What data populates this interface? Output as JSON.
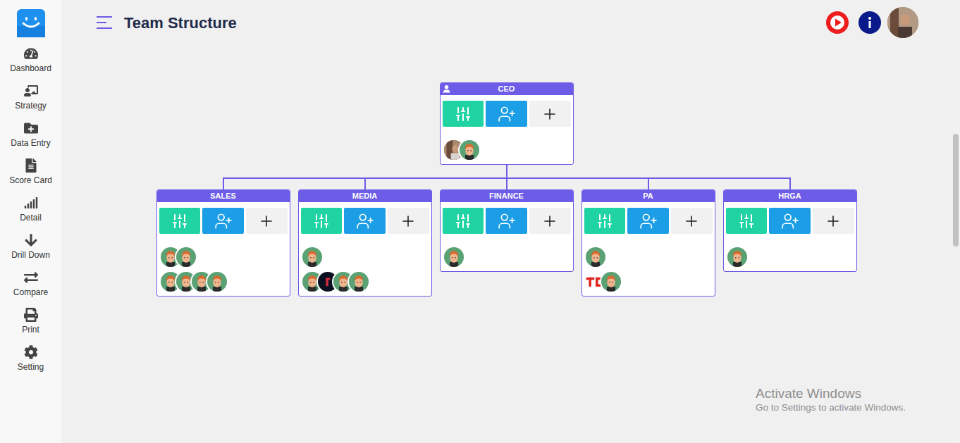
{
  "sidebar": {
    "items": [
      {
        "label": "Dashboard"
      },
      {
        "label": "Strategy"
      },
      {
        "label": "Data Entry"
      },
      {
        "label": "Score Card"
      },
      {
        "label": "Detail"
      },
      {
        "label": "Drill Down"
      },
      {
        "label": "Compare"
      },
      {
        "label": "Print"
      },
      {
        "label": "Setting"
      }
    ]
  },
  "header": {
    "title": "Team Structure"
  },
  "chart": {
    "root": {
      "title": "CEO",
      "avatar_rows": [
        [
          {
            "kind": "photo"
          },
          {
            "kind": "cartoon"
          }
        ]
      ]
    },
    "children": [
      {
        "title": "SALES",
        "avatar_rows": [
          [
            {
              "kind": "cartoon"
            },
            {
              "kind": "cartoon"
            }
          ],
          [
            {
              "kind": "cartoon"
            },
            {
              "kind": "cartoon"
            },
            {
              "kind": "cartoon"
            },
            {
              "kind": "cartoon"
            }
          ]
        ]
      },
      {
        "title": "MEDIA",
        "avatar_rows": [
          [
            {
              "kind": "cartoon"
            }
          ],
          [
            {
              "kind": "cartoon"
            },
            {
              "kind": "dark-logo"
            },
            {
              "kind": "cartoon"
            },
            {
              "kind": "cartoon"
            }
          ]
        ]
      },
      {
        "title": "FINANCE",
        "avatar_rows": [
          [
            {
              "kind": "cartoon"
            }
          ]
        ]
      },
      {
        "title": "PA",
        "avatar_rows": [
          [
            {
              "kind": "cartoon"
            }
          ],
          [
            {
              "kind": "red-logo"
            },
            {
              "kind": "cartoon"
            }
          ]
        ]
      },
      {
        "title": "HRGA",
        "avatar_rows": [
          [
            {
              "kind": "cartoon"
            }
          ]
        ]
      }
    ]
  },
  "watermark": {
    "title": "Activate Windows",
    "subtitle": "Go to Settings to activate Windows."
  }
}
